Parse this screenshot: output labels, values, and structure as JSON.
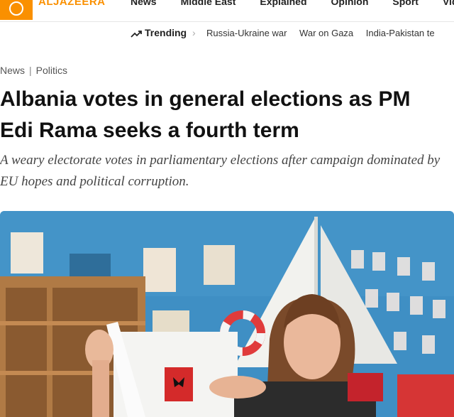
{
  "header": {
    "logo_text": "ALJAZEERA",
    "nav": [
      "News",
      "Middle East",
      "Explained",
      "Opinion",
      "Sport",
      "Video"
    ]
  },
  "trending": {
    "label": "Trending",
    "links": [
      "Russia-Ukraine war",
      "War on Gaza",
      "India-Pakistan te"
    ]
  },
  "breadcrumb": {
    "section": "News",
    "subsection": "Politics"
  },
  "article": {
    "headline": "Albania votes in general elections as PM Edi Rama seeks a fourth term",
    "subheadline": "A weary electorate votes in parliamentary elections after campaign dominated by EU hopes and political corruption."
  },
  "colors": {
    "brand": "#fa9000",
    "headline": "#111111",
    "photo_wall": "#3f8fc4"
  }
}
